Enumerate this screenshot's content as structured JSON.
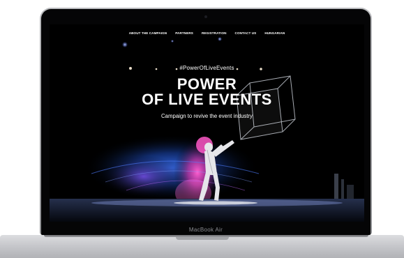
{
  "device": {
    "model_label": "MacBook Air"
  },
  "nav": {
    "items": [
      "ABOUT THE CAMPAIGN",
      "PARTNERS",
      "REGISTRATION",
      "CONTACT US",
      "HUNGARIAN"
    ]
  },
  "hero": {
    "hashtag": "#PowerOfLiveEvents",
    "title_line1": "POWER",
    "title_line2": "OF LIVE EVENTS",
    "subtitle": "Campaign to revive the event industry"
  },
  "colors": {
    "screen_background": "#000000",
    "text": "#ffffff",
    "stage_glow_blue": "#1e5bd8",
    "stage_glow_magenta": "#c0309a",
    "laptop_silver": "#c7c8cc"
  }
}
